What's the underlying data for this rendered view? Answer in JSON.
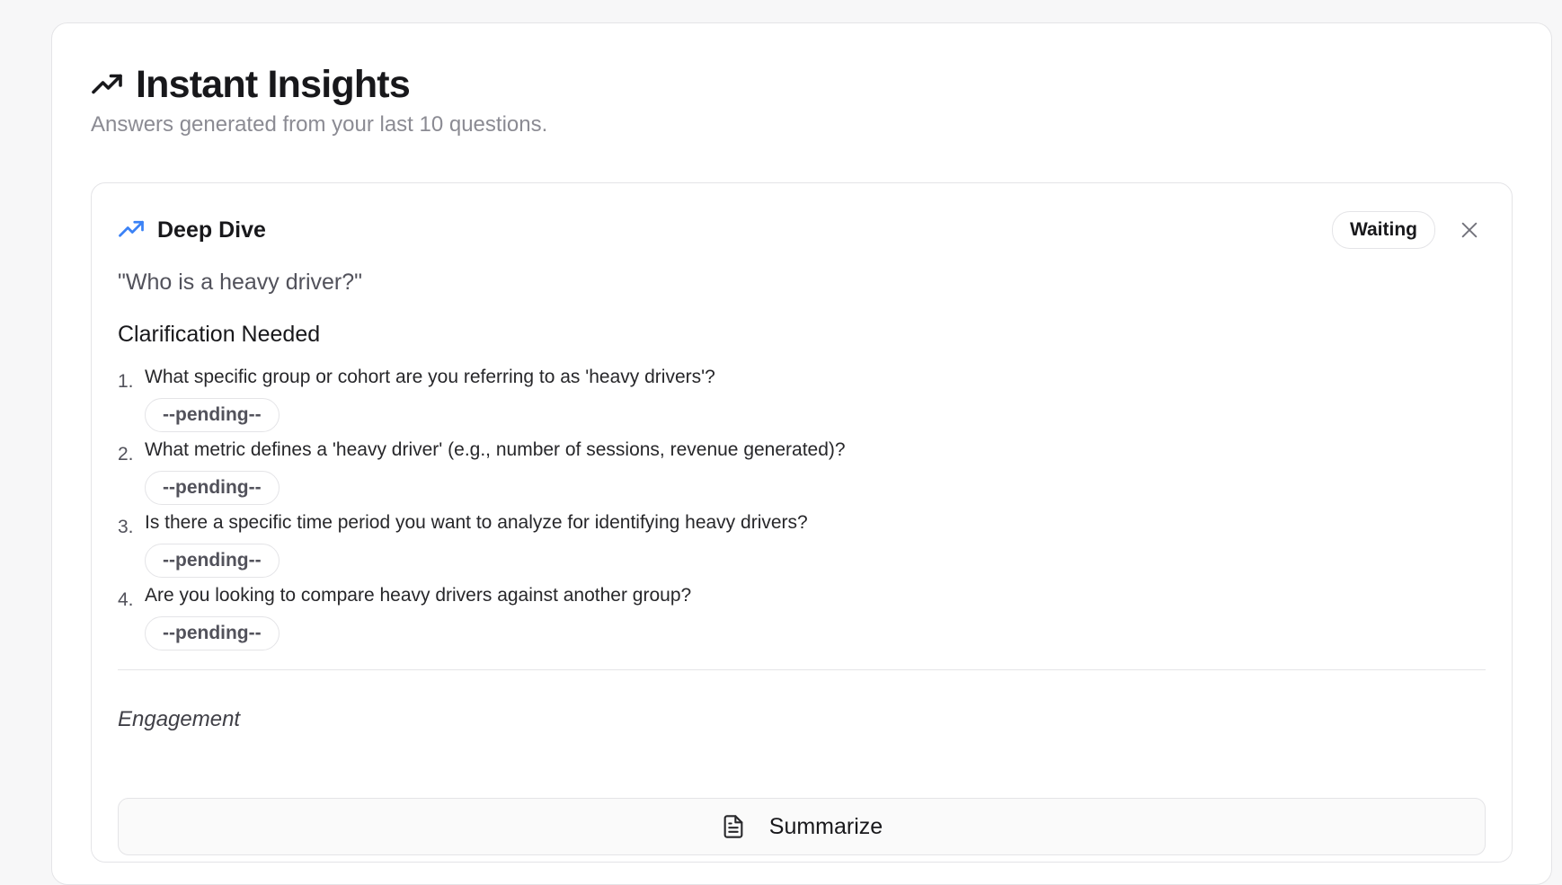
{
  "header": {
    "title": "Instant Insights",
    "subtitle": "Answers generated from your last 10 questions.",
    "icon": "trending-up-icon"
  },
  "card": {
    "title": "Deep Dive",
    "icon": "trending-up-icon",
    "accent_color": "#3b82f6",
    "status_badge": "Waiting",
    "question": "\"Who is a heavy driver?\"",
    "section_title": "Clarification Needed",
    "clarifications": [
      {
        "number": "1.",
        "text": "What specific group or cohort are you referring to as 'heavy drivers'?",
        "answer": "--pending--"
      },
      {
        "number": "2.",
        "text": "What metric defines a 'heavy driver' (e.g., number of sessions, revenue generated)?",
        "answer": "--pending--"
      },
      {
        "number": "3.",
        "text": "Is there a specific time period you want to analyze for identifying heavy drivers?",
        "answer": "--pending--"
      },
      {
        "number": "4.",
        "text": "Are you looking to compare heavy drivers against another group?",
        "answer": "--pending--"
      }
    ],
    "category": "Engagement",
    "summarize_label": "Summarize"
  }
}
